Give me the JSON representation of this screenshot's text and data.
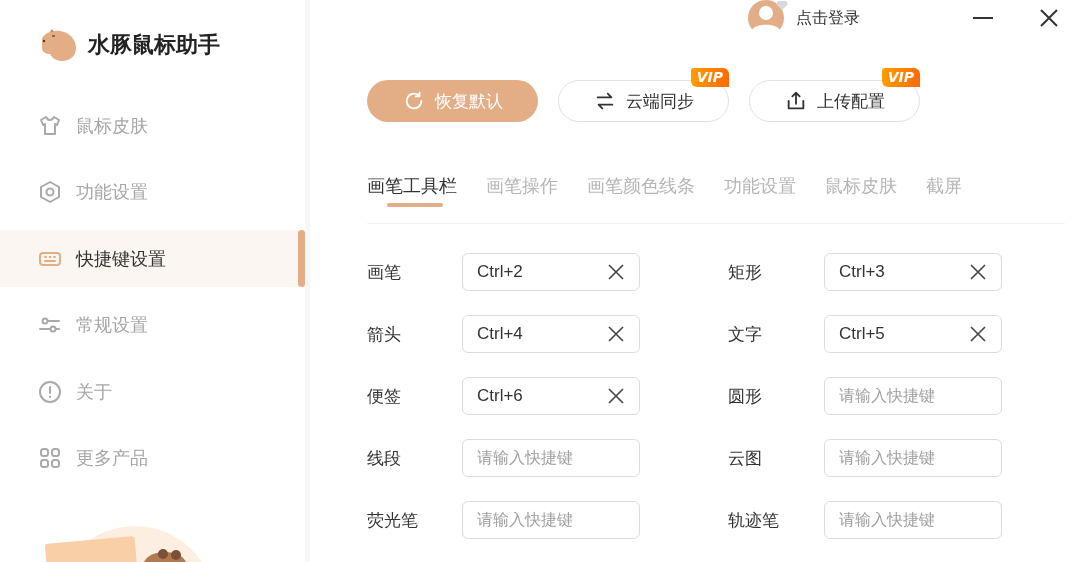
{
  "app": {
    "title": "水豚鼠标助手"
  },
  "user": {
    "login": "点击登录"
  },
  "sidebar": {
    "items": [
      {
        "kind": "shirt",
        "label": "鼠标皮肤",
        "selected": false
      },
      {
        "kind": "hexagon",
        "label": "功能设置",
        "selected": false
      },
      {
        "kind": "keyboard",
        "label": "快捷键设置",
        "selected": true
      },
      {
        "kind": "sliders",
        "label": "常规设置",
        "selected": false
      },
      {
        "kind": "info",
        "label": "关于",
        "selected": false
      },
      {
        "kind": "grid",
        "label": "更多产品",
        "selected": false
      }
    ]
  },
  "actions": [
    {
      "kind": "reset",
      "label": "恢复默认",
      "primary": true
    },
    {
      "kind": "sync",
      "label": "云端同步",
      "primary": false,
      "badge": "VIP"
    },
    {
      "kind": "upload",
      "label": "上传配置",
      "primary": false,
      "badge": "VIP"
    }
  ],
  "tabs": [
    {
      "label": "画笔工具栏",
      "selected": true
    },
    {
      "label": "画笔操作",
      "selected": false
    },
    {
      "label": "画笔颜色线条",
      "selected": false
    },
    {
      "label": "功能设置",
      "selected": false
    },
    {
      "label": "鼠标皮肤",
      "selected": false
    },
    {
      "label": "截屏",
      "selected": false
    }
  ],
  "shortcuts": [
    {
      "label": "画笔",
      "value": "Ctrl+2"
    },
    {
      "label": "矩形",
      "value": "Ctrl+3"
    },
    {
      "label": "箭头",
      "value": "Ctrl+4"
    },
    {
      "label": "文字",
      "value": "Ctrl+5"
    },
    {
      "label": "便签",
      "value": "Ctrl+6"
    },
    {
      "label": "圆形",
      "placeholder": "请输入快捷键"
    },
    {
      "label": "线段",
      "placeholder": "请输入快捷键"
    },
    {
      "label": "云图",
      "placeholder": "请输入快捷键"
    },
    {
      "label": "荧光笔",
      "placeholder": "请输入快捷键"
    },
    {
      "label": "轨迹笔",
      "placeholder": "请输入快捷键"
    }
  ]
}
